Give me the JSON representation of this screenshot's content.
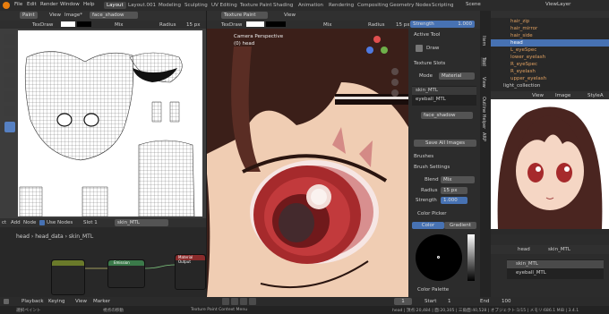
{
  "topbar": {
    "menus": [
      "File",
      "Edit",
      "Render",
      "Window",
      "Help"
    ],
    "tabs": [
      "Layout",
      "Layout.001",
      "Modeling",
      "Sculpting",
      "UV Editing",
      "Texture Paint",
      "Shading",
      "Animation",
      "Rendering",
      "Compositing",
      "Geometry Nodes",
      "Scripting"
    ],
    "active_tab": "Layout",
    "scene": "Scene",
    "viewlayer": "ViewLayer"
  },
  "image_editor": {
    "mode": "Paint",
    "menus": [
      "View",
      "Image*"
    ],
    "image_name": "face_shadow",
    "brush": "TexDraw",
    "blend": "Mix",
    "radius_label": "Radius",
    "radius_value": "15 px"
  },
  "viewport": {
    "mode": "Texture Paint",
    "menu": "View",
    "brush": "TexDraw",
    "blend": "Mix",
    "radius": "Radius",
    "radius_value": "15 px",
    "strength": "Strength",
    "strength_value": "1.000",
    "overlay_title": "Camera Perspective",
    "overlay_sub": "(0) head"
  },
  "properties": {
    "active_tool": "Active Tool",
    "tool_name": "Draw",
    "texture_slots": "Texture Slots",
    "mode_label": "Mode",
    "mode_value": "Material",
    "slots": [
      "skin_MTL",
      "eyeball_MTL"
    ],
    "image_slot": "face_shadow",
    "save_all": "Save All Images",
    "brushes": "Brushes",
    "brush_settings": "Brush Settings",
    "blend_label": "Blend",
    "blend_value": "Mix",
    "radius_label": "Radius",
    "radius_value": "15 px",
    "strength_label": "Strength",
    "strength_value": "1.000",
    "color_picker": "Color Picker",
    "color_tab": "Color",
    "gradient_tab": "Gradient",
    "color_palette": "Color Palette",
    "side_tabs": [
      "Tool",
      "Item",
      "View",
      "ARP",
      "Outline Helper"
    ]
  },
  "outliner": {
    "items": [
      "hair_zip",
      "hair_mirror",
      "hair_side",
      "head",
      "L_eyeSpec",
      "lower_eyelash",
      "R_eyeSpec",
      "R_eyelash",
      "upper_eyelash",
      "light_collection"
    ],
    "selected": "head"
  },
  "preview": {
    "menus": [
      "View",
      "View",
      "Image"
    ],
    "image": "StyleA"
  },
  "material_panel": {
    "breadcrumb_obj": "head",
    "breadcrumb_mat": "skin_MTL",
    "slots": [
      "skin_MTL",
      "eyeball_MTL"
    ]
  },
  "node_editor": {
    "menus": [
      "ct",
      "Add",
      "Node"
    ],
    "use_nodes": "Use Nodes",
    "slot": "Slot 1",
    "material": "skin_MTL",
    "crumbs": [
      "head",
      "head_data",
      "skin_MTL"
    ],
    "nodes": [
      "Emission",
      "Material Output"
    ]
  },
  "timeline": {
    "menus": [
      "Playback",
      "Keying",
      "View",
      "Marker"
    ],
    "start_label": "Start",
    "start": "1",
    "end_label": "End",
    "end": "100",
    "frame": "1"
  },
  "status": {
    "left": "選択ペイント",
    "mid": "視点の移動",
    "center": "Texture Paint Context Menu",
    "right": "head | 頂点:20,484 | 面:20,305 | 三角面:40,528 | オブジェクト:1/15 | メモリ:686.1 MiB | 3.4.1"
  },
  "colors": {
    "accent": "#4772b3",
    "skin": "#f2cdb5",
    "hair": "#3a1d18",
    "iris": "#a62a2c"
  }
}
